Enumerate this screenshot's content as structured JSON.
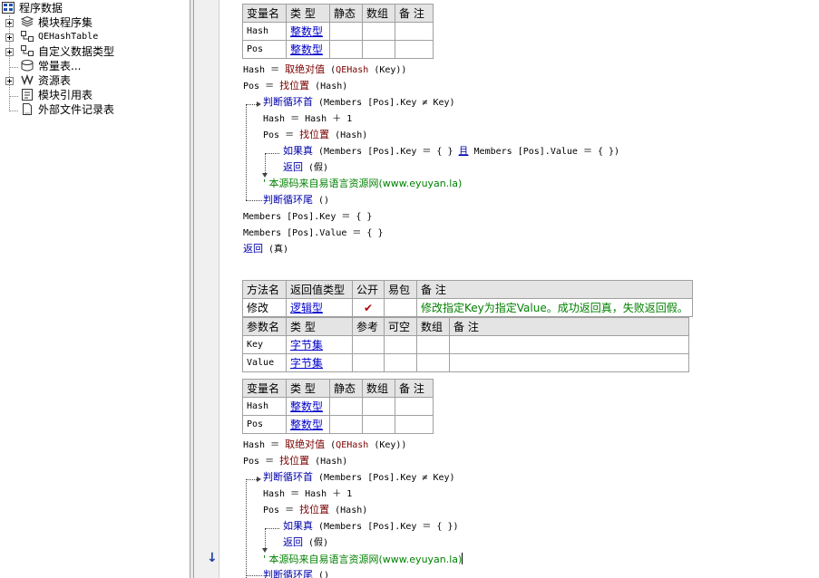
{
  "tree": {
    "root": "程序数据",
    "items": [
      "模块程序集",
      "QEHashTable",
      "自定义数据类型",
      "常量表...",
      "资源表",
      "模块引用表",
      "外部文件记录表"
    ]
  },
  "block1": {
    "vars_header": [
      "变量名",
      "类 型",
      "静态",
      "数组",
      "备 注"
    ],
    "vars": [
      {
        "name": "Hash",
        "type": "整数型"
      },
      {
        "name": "Pos",
        "type": "整数型"
      }
    ],
    "lines": {
      "l1": {
        "a": "Hash ＝ ",
        "fn": "取绝对值",
        "b": " (",
        "arg": "QEHash",
        "c": " (Key))"
      },
      "l2": {
        "a": "Pos ＝ ",
        "fn": "找位置",
        "b": " (Hash)"
      },
      "l3": {
        "kw": "判断循环首",
        "b": " (Members [Pos].Key ≠ Key)"
      },
      "l4": {
        "a": "Hash ＝ Hash ＋ 1"
      },
      "l5": {
        "a": "Pos ＝ ",
        "fn": "找位置",
        "b": " (Hash)"
      },
      "l6": {
        "kw": "如果真",
        "b": " (Members [Pos].Key ＝ {  } ",
        "kw2": "且",
        "c": " Members [Pos].Value ＝ {  })"
      },
      "l7": {
        "kw": "返回",
        "b": " (假)"
      },
      "l8": {
        "cm": "' 本源码来自易语言资源网(www.eyuyan.la)"
      },
      "l9": {
        "kw": "判断循环尾",
        "b": " ()"
      },
      "l10": {
        "a": "Members [Pos].Key ＝ {  }"
      },
      "l11": {
        "a": "Members [Pos].Value ＝ {  }"
      },
      "l12": {
        "kw": "返回",
        "b": " (真)"
      }
    }
  },
  "method": {
    "header": [
      "方法名",
      "返回值类型",
      "公开",
      "易包",
      "备 注"
    ],
    "name": "修改",
    "return_type": "逻辑型",
    "public_mark": "✔",
    "remark": "修改指定Key为指定Value。成功返回真，失败返回假。",
    "params_header": [
      "参数名",
      "类 型",
      "参考",
      "可空",
      "数组",
      "备 注"
    ],
    "params": [
      {
        "name": "Key",
        "type": "字节集"
      },
      {
        "name": "Value",
        "type": "字节集"
      }
    ]
  },
  "block2": {
    "vars_header": [
      "变量名",
      "类 型",
      "静态",
      "数组",
      "备 注"
    ],
    "vars": [
      {
        "name": "Hash",
        "type": "整数型"
      },
      {
        "name": "Pos",
        "type": "整数型"
      }
    ],
    "lines": {
      "l1": {
        "a": "Hash ＝ ",
        "fn": "取绝对值",
        "b": " (",
        "arg": "QEHash",
        "c": " (Key))"
      },
      "l2": {
        "a": "Pos ＝ ",
        "fn": "找位置",
        "b": " (Hash)"
      },
      "l3": {
        "kw": "判断循环首",
        "b": " (Members [Pos].Key ≠ Key)"
      },
      "l4": {
        "a": "Hash ＝ Hash ＋ 1"
      },
      "l5": {
        "a": "Pos ＝ ",
        "fn": "找位置",
        "b": " (Hash)"
      },
      "l6": {
        "kw": "如果真",
        "b": " (Members [Pos].Key ＝ {  })"
      },
      "l7": {
        "kw": "返回",
        "b": " (假)"
      },
      "l8": {
        "cm": "' 本源码来自易语言资源网(www.eyuyan.la)"
      },
      "l9": {
        "kw": "判断循环尾",
        "b": " ()"
      }
    }
  }
}
